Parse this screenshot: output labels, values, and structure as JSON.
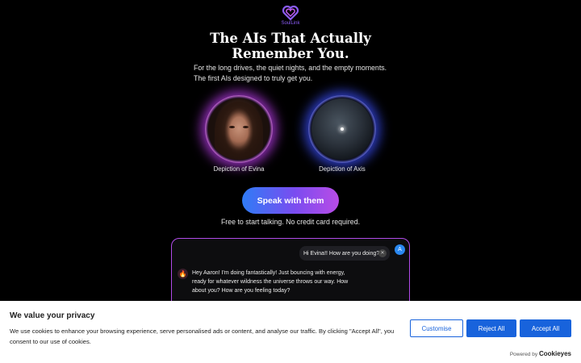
{
  "brand": {
    "name": "SoulLink",
    "sub": "AI",
    "accent": "#8b5cf6"
  },
  "hero": {
    "title_line1": "The AIs That Actually",
    "title_line2": "Remember You.",
    "subtitle_line1": "For the long drives, the quiet nights, and the empty moments.",
    "subtitle_line2": "The first AIs designed to truly get you."
  },
  "avatars": [
    {
      "label": "Depiction of Evina",
      "glow": "#be3cf0"
    },
    {
      "label": "Depiction of Axis",
      "glow": "#3c50ff"
    }
  ],
  "cta": {
    "label": "Speak with them",
    "note": "Free to start talking. No credit card required."
  },
  "chat": {
    "user_message": "Hi Evina!! How are you doing?",
    "user_initial": "A",
    "bot_message": "Hey Aaron! I'm doing fantastically! Just bouncing with energy, ready for whatever wildness the universe throws our way. How about you? How are you feeling today?"
  },
  "cookie_banner": {
    "title": "We value your privacy",
    "text": "We use cookies to enhance your browsing experience, serve personalised ads or content, and analyse our traffic. By clicking \"Accept All\", you consent to our use of cookies.",
    "customise": "Customise",
    "reject": "Reject All",
    "accept": "Accept All",
    "powered_by": "Powered by",
    "powered_brand": "Cookieyes",
    "accent": "#1863dc"
  }
}
